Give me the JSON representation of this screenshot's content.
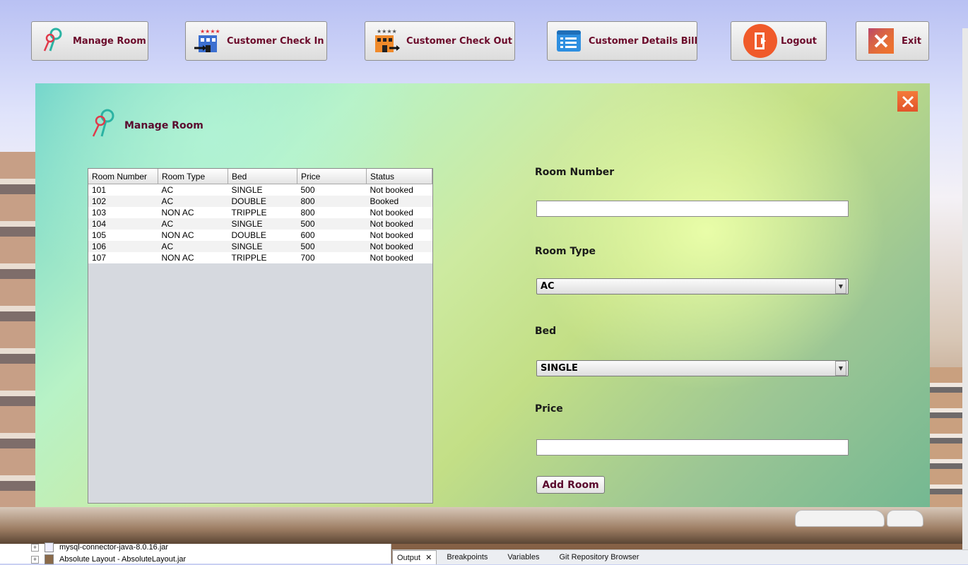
{
  "toolbar": {
    "manage_room": "Manage Room",
    "check_in": "Customer Check In",
    "check_out": "Customer Check Out",
    "details_bill": "Customer Details Bill",
    "logout": "Logout",
    "exit": "Exit"
  },
  "panel": {
    "title": "Manage Room"
  },
  "table": {
    "headers": [
      "Room Number",
      "Room Type",
      "Bed",
      "Price",
      "Status"
    ],
    "rows": [
      [
        "101",
        "AC",
        "SINGLE",
        "500",
        "Not booked"
      ],
      [
        "102",
        "AC",
        "DOUBLE",
        "800",
        "Booked"
      ],
      [
        "103",
        "NON AC",
        "TRIPPLE",
        "800",
        "Not booked"
      ],
      [
        "104",
        "AC",
        "SINGLE",
        "500",
        "Not booked"
      ],
      [
        "105",
        "NON AC",
        "DOUBLE",
        "600",
        "Not booked"
      ],
      [
        "106",
        "AC",
        "SINGLE",
        "500",
        "Not booked"
      ],
      [
        "107",
        "NON AC",
        "TRIPPLE",
        "700",
        "Not booked"
      ]
    ]
  },
  "form": {
    "room_number_label": "Room Number",
    "room_number_value": "",
    "room_type_label": "Room Type",
    "room_type_value": "AC",
    "bed_label": "Bed",
    "bed_value": "SINGLE",
    "price_label": "Price",
    "price_value": "",
    "add_button": "Add Room"
  },
  "ide": {
    "tree": [
      "mysql-connector-java-8.0.16.jar",
      "Absolute Layout - AbsoluteLayout.jar"
    ],
    "tabs": [
      "Output",
      "Breakpoints",
      "Variables",
      "Git Repository Browser"
    ]
  },
  "colors": {
    "label_maroon": "#6b0a2a",
    "close_orange": "#e8602e"
  }
}
